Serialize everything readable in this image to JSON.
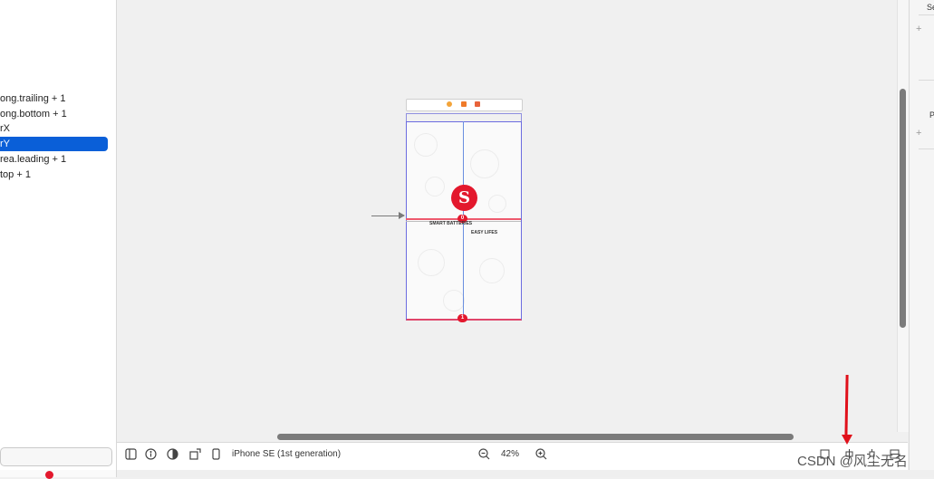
{
  "constraints_list": {
    "items": [
      {
        "label": "ong.trailing + 1",
        "selected": false
      },
      {
        "label": "ong.bottom + 1",
        "selected": false
      },
      {
        "label": "rX",
        "selected": false
      },
      {
        "label": "rY",
        "selected": true
      },
      {
        "label": "rea.leading + 1",
        "selected": false
      },
      {
        "label": "top + 1",
        "selected": false
      }
    ]
  },
  "canvas": {
    "device_labels": {
      "left_caption": "SMART BATTERIES",
      "right_caption": "EASY LIFES"
    },
    "constraint_badges": {
      "center_y_badge": "0",
      "bottom_badge": "1"
    },
    "logo_glyph": "S"
  },
  "bottom_bar": {
    "device_name": "iPhone SE (1st generation)",
    "zoom_level": "42%"
  },
  "inspector": {
    "se_label": "Se",
    "p_label": "P"
  },
  "watermark": "CSDN @风尘无名",
  "colors": {
    "selection": "#0a5fd8",
    "constraint_red": "#e3182d",
    "guide_blue": "#6a8fe0",
    "annotation_arrow": "#e0101a"
  }
}
